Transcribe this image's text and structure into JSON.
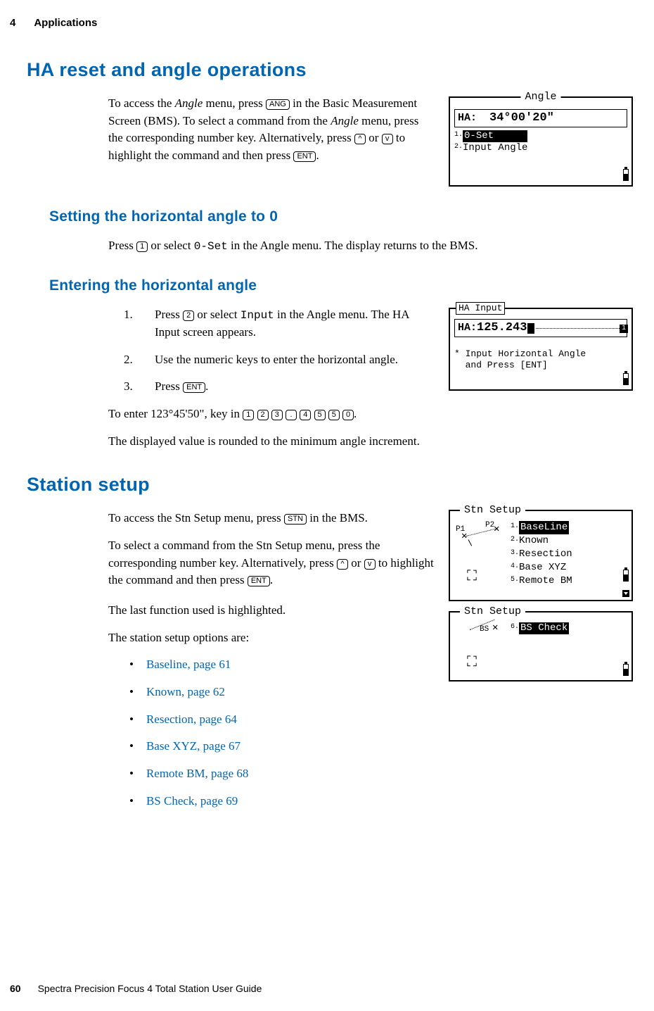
{
  "header": {
    "chapter_num": "4",
    "chapter_title": "Applications"
  },
  "h1_a": "HA reset and angle operations",
  "intro_a": {
    "t1a": "To access the ",
    "t1b": "Angle",
    "t1c": " menu, press ",
    "key_ang": "ANG",
    "t1d": " in the Basic Measurement Screen (BMS). To select a command from the ",
    "t1e": "Angle",
    "t1f": " menu, press the corresponding number key. Alternatively, press ",
    "key_up": "^",
    "t1g": " or ",
    "key_dn": "v",
    "t1h": " to highlight the command and then press ",
    "key_ent": "ENT",
    "t1i": "."
  },
  "h2_a": "Setting the horizontal angle to 0",
  "para_set0": {
    "t1": "Press ",
    "key1": "1",
    "t2": " or select ",
    "mono": "0-Set",
    "t3": " in the Angle menu. The display returns to the BMS."
  },
  "h2_b": "Entering the horizontal angle",
  "enter_list": {
    "i1": {
      "num": "1.",
      "t1": "Press ",
      "key": "2",
      "t2": " or select ",
      "mono": "Input",
      "t3": " in the Angle menu. The HA Input screen appears."
    },
    "i2": {
      "num": "2.",
      "t1": "Use the numeric keys to enter the horizontal angle."
    },
    "i3": {
      "num": "3.",
      "t1": "Press ",
      "key": "ENT",
      "t2": "."
    }
  },
  "para_example": {
    "t1": "To enter 123°45'50\", key in ",
    "k1": "1",
    "k2": "2",
    "k3": "3",
    "k4": ".",
    "k5": "4",
    "k6": "5",
    "k7": "5",
    "k8": "0",
    "t2": "."
  },
  "para_rounded": "The displayed value is rounded to the minimum angle increment.",
  "h1_b": "Station setup",
  "stn_intro": {
    "p1a": "To access the Stn Setup menu, press ",
    "key_stn": "STN",
    "p1b": " in the BMS.",
    "p2a": "To select a command from the Stn Setup menu, press the corresponding number key. Alternatively, press ",
    "key_up": "^",
    "p2b": " or ",
    "key_dn": "v",
    "p2c": " to highlight the command and then press ",
    "key_ent": "ENT",
    "p2d": "."
  },
  "stn_last": "The last function used is highlighted.",
  "stn_options_lead": "The station setup options are:",
  "links": {
    "l1": "Baseline, page 61",
    "l2": "Known, page 62",
    "l3": "Resection, page 64",
    "l4": "Base XYZ, page 67",
    "l5": "Remote BM, page 68",
    "l6": "BS Check, page 69"
  },
  "footer": {
    "page": "60",
    "guide": "Spectra Precision Focus 4 Total Station User Guide"
  },
  "lcd_angle": {
    "title": "Angle",
    "ha_label": "HA:",
    "ha_value": "34°00'20\"",
    "item1_num": "1.",
    "item1": "0-Set",
    "item2_num": "2.",
    "item2": "Input Angle"
  },
  "lcd_hainput": {
    "title": "HA Input",
    "ha_label": "HA:",
    "ha_value": "125.243",
    "msg1": "* Input Horizontal Angle",
    "msg2": "  and Press [ENT]"
  },
  "lcd_stn1": {
    "title": "Stn Setup",
    "p1": "P1",
    "p2": "P2",
    "i1n": "1.",
    "i1": "BaseLine",
    "i2n": "2.",
    "i2": "Known",
    "i3n": "3.",
    "i3": "Resection",
    "i4n": "4.",
    "i4": "Base XYZ",
    "i5n": "5.",
    "i5": "Remote BM"
  },
  "lcd_stn2": {
    "title": "Stn Setup",
    "bs": "BS",
    "i6n": "6.",
    "i6": "BS Check"
  }
}
